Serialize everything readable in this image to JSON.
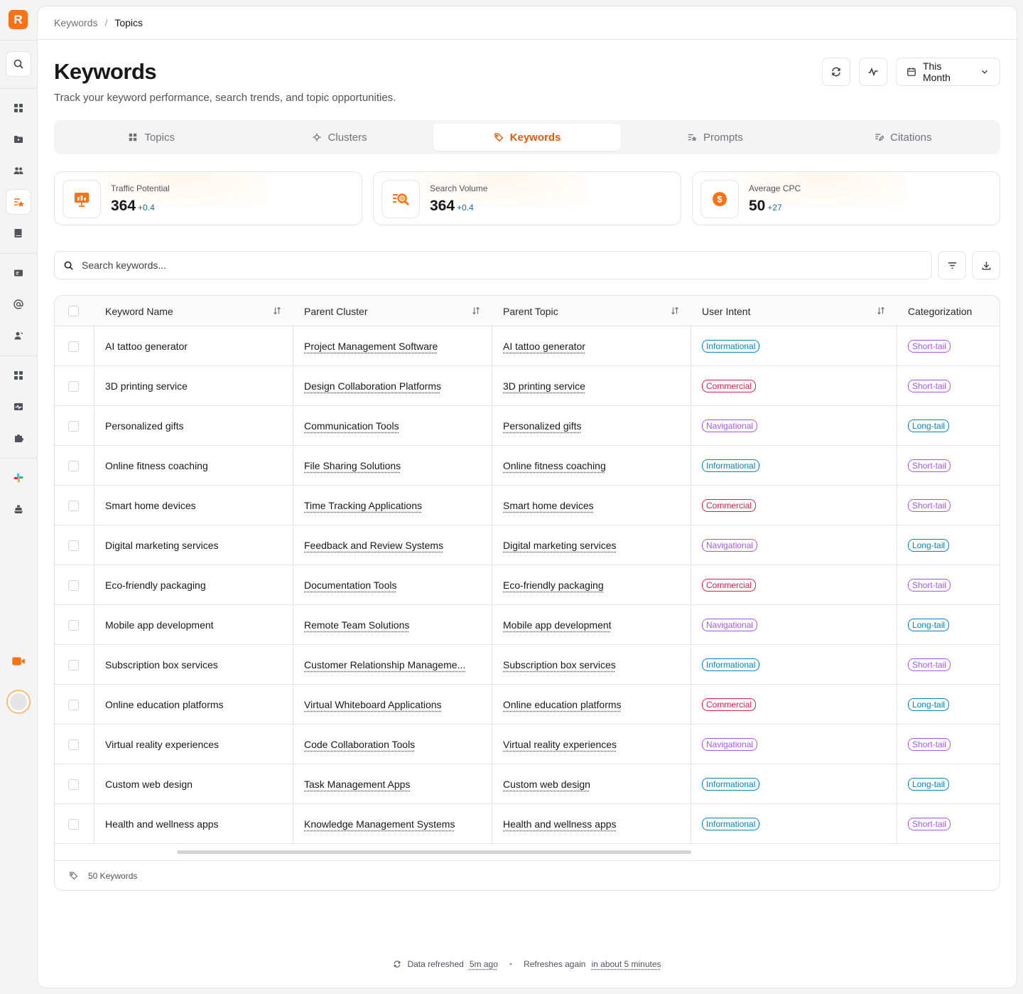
{
  "breadcrumb": {
    "parent": "Keywords",
    "separator": "/",
    "current": "Topics"
  },
  "page": {
    "title": "Keywords",
    "subtitle": "Track your keyword performance, search trends, and topic opportunities."
  },
  "header_controls": {
    "date_range": "This Month"
  },
  "tabs": [
    {
      "label": "Topics",
      "icon": "grid-icon",
      "active": false
    },
    {
      "label": "Clusters",
      "icon": "cluster-icon",
      "active": false
    },
    {
      "label": "Keywords",
      "icon": "tag-icon",
      "active": true
    },
    {
      "label": "Prompts",
      "icon": "prompts-icon",
      "active": false
    },
    {
      "label": "Citations",
      "icon": "citations-icon",
      "active": false
    }
  ],
  "stats": [
    {
      "label": "Traffic Potential",
      "value": "364",
      "delta": "+0.4",
      "icon": "presentation-chart-icon"
    },
    {
      "label": "Search Volume",
      "value": "364",
      "delta": "+0.4",
      "icon": "search-list-icon"
    },
    {
      "label": "Average CPC",
      "value": "50",
      "delta": "+27",
      "icon": "dollar-coin-icon"
    }
  ],
  "search": {
    "placeholder": "Search keywords..."
  },
  "table": {
    "columns": [
      "Keyword Name",
      "Parent Cluster",
      "Parent Topic",
      "User Intent",
      "Categorization"
    ],
    "rows": [
      {
        "keyword": "AI tattoo generator",
        "cluster": "Project Management Software",
        "topic": "AI tattoo generator",
        "intent": "Informational",
        "category": "Short-tail"
      },
      {
        "keyword": "3D printing service",
        "cluster": "Design Collaboration Platforms",
        "topic": "3D printing service",
        "intent": "Commercial",
        "category": "Short-tail"
      },
      {
        "keyword": "Personalized gifts",
        "cluster": "Communication Tools",
        "topic": "Personalized gifts",
        "intent": "Navigational",
        "category": "Long-tail"
      },
      {
        "keyword": "Online fitness coaching",
        "cluster": "File Sharing Solutions",
        "topic": "Online fitness coaching",
        "intent": "Informational",
        "category": "Short-tail"
      },
      {
        "keyword": "Smart home devices",
        "cluster": "Time Tracking Applications",
        "topic": "Smart home devices",
        "intent": "Commercial",
        "category": "Short-tail"
      },
      {
        "keyword": "Digital marketing services",
        "cluster": "Feedback and Review Systems",
        "topic": "Digital marketing services",
        "intent": "Navigational",
        "category": "Long-tail"
      },
      {
        "keyword": "Eco-friendly packaging",
        "cluster": "Documentation Tools",
        "topic": "Eco-friendly packaging",
        "intent": "Commercial",
        "category": "Short-tail"
      },
      {
        "keyword": "Mobile app development",
        "cluster": "Remote Team Solutions",
        "topic": "Mobile app development",
        "intent": "Navigational",
        "category": "Long-tail"
      },
      {
        "keyword": "Subscription box services",
        "cluster": "Customer Relationship Manageme...",
        "topic": "Subscription box services",
        "intent": "Informational",
        "category": "Short-tail"
      },
      {
        "keyword": "Online education platforms",
        "cluster": "Virtual Whiteboard Applications",
        "topic": "Online education platforms",
        "intent": "Commercial",
        "category": "Long-tail"
      },
      {
        "keyword": "Virtual reality experiences",
        "cluster": "Code Collaboration Tools",
        "topic": "Virtual reality experiences",
        "intent": "Navigational",
        "category": "Short-tail"
      },
      {
        "keyword": "Custom web design",
        "cluster": "Task Management Apps",
        "topic": "Custom web design",
        "intent": "Informational",
        "category": "Long-tail"
      },
      {
        "keyword": "Health and wellness apps",
        "cluster": "Knowledge Management Systems",
        "topic": "Health and wellness apps",
        "intent": "Informational",
        "category": "Short-tail"
      }
    ],
    "footer_count": "50 Keywords"
  },
  "badge_colors": {
    "Informational": "#0284c7",
    "Commercial": "#e11d48",
    "Navigational": "#a855f7",
    "Short-tail": "#a855f7",
    "Long-tail": "#0284c7"
  },
  "refresh": {
    "label": "Data refreshed",
    "ago": "5m ago",
    "next_label": "Refreshes again",
    "next": "in about 5 minutes"
  },
  "colors": {
    "accent": "#f97316",
    "accent_text": "#ea580c",
    "delta": "#0e7490"
  }
}
